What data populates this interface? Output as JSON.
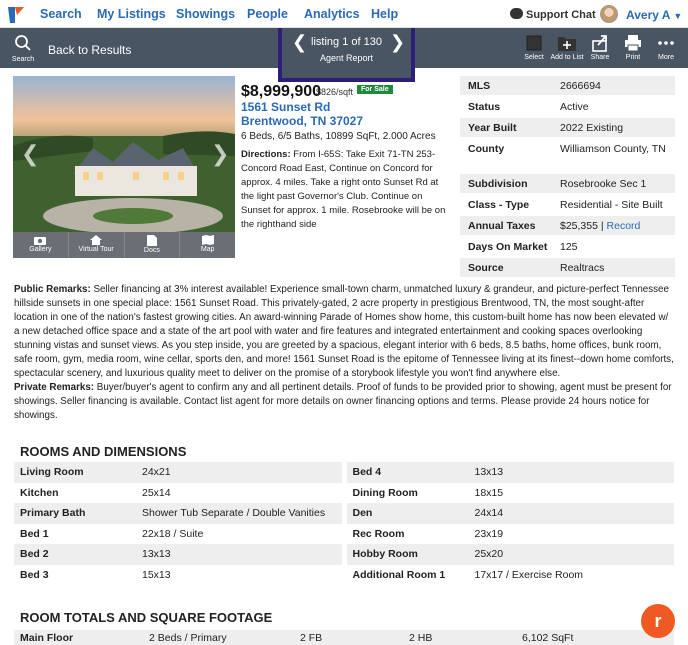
{
  "nav": {
    "links": [
      "Search",
      "My Listings",
      "Showings",
      "People",
      "Analytics",
      "Help"
    ],
    "support": "Support Chat",
    "user": "Avery A"
  },
  "toolbar": {
    "search_label": "Search",
    "back_label": "Back to Results",
    "listing_count": "listing 1 of 130",
    "report": "Agent Report",
    "actions": [
      "Select",
      "Add to List",
      "Share",
      "Print",
      "More"
    ]
  },
  "photo_tabs": [
    "Gallery",
    "Virtual Tour",
    "Docs",
    "Map"
  ],
  "listing": {
    "price": "$8,999,900",
    "price_sqft": "$826/sqft",
    "status_badge": "For Sale",
    "street": "1561 Sunset Rd",
    "city": "Brentwood, TN 37027",
    "summary": "6 Beds, 6/5 Baths, 10899 SqFt, 2.000 Acres",
    "directions_label": "Directions:",
    "directions": "From I-65S: Take Exit 71-TN 253-Concord Road East, Continue on Concord for approx. 4 miles. Take a right onto Sunset Rd at the light past Governor's Club. Continue on Sunset for approx. 1 mile. Rosebrooke will be on the righthand side"
  },
  "info": [
    {
      "k": "MLS",
      "v": "2666694"
    },
    {
      "k": "Status",
      "v": "Active"
    },
    {
      "k": "Year Built",
      "v": "2022 Existing"
    },
    {
      "k": "County",
      "v": "Williamson County, TN"
    },
    {
      "k": "Subdivision",
      "v": "Rosebrooke Sec 1"
    },
    {
      "k": "Class - Type",
      "v": "Residential - Site Built"
    },
    {
      "k": "Annual Taxes",
      "v": "$25,355",
      "link": "Record"
    },
    {
      "k": "Days On Market",
      "v": "125"
    },
    {
      "k": "Source",
      "v": "Realtracs"
    }
  ],
  "remarks": {
    "public_label": "Public Remarks:",
    "public": "Seller financing at 3% interest available! Experience small-town charm, unmatched luxury & grandeur, and picture-perfect Tennessee hillside sunsets in one special place: 1561 Sunset Road. This privately-gated, 2 acre property in prestigious Brentwood, TN, the most sought-after location in one of the nation's fastest growing cities. An award-winning Parade of Homes show home, this custom-built home has now been elevated w/ a new detached office space and a state of the art pool with water and fire features and integrated entertainment and cooking spaces overlooking stunning vistas and sunset views. As you step inside, you are greeted by a spacious, elegant interior with 6 beds, 8.5 baths, home offices, bunk room, safe room, gym, media room, wine cellar, sports den, and more! 1561 Sunset Road is the epitome of Tennessee living at its finest--down home comforts, spectacular scenery, and luxurious quality meet to deliver on the promise of a storybook lifestyle you won't find anywhere else.",
    "private_label": "Private Remarks:",
    "private": "Buyer/buyer's agent to confirm any and all pertinent details. Proof of funds to be provided prior to showing, agent must be present for showings. Seller financing is available. Contact list agent for more details on owner financing options and terms. Please provide 24 hours notice for showings."
  },
  "rooms_title": "ROOMS AND DIMENSIONS",
  "rooms": [
    [
      {
        "k": "Living Room",
        "v": "24x21"
      },
      {
        "k": "Bed 4",
        "v": "13x13"
      }
    ],
    [
      {
        "k": "Kitchen",
        "v": "25x14"
      },
      {
        "k": "Dining Room",
        "v": "18x15"
      }
    ],
    [
      {
        "k": "Primary Bath",
        "v": "Shower Tub Separate / Double Vanities"
      },
      {
        "k": "Den",
        "v": "24x14"
      }
    ],
    [
      {
        "k": "Bed 1",
        "v": "22x18 / Suite"
      },
      {
        "k": "Rec Room",
        "v": "23x19"
      }
    ],
    [
      {
        "k": "Bed 2",
        "v": "13x13"
      },
      {
        "k": "Hobby Room",
        "v": "25x20"
      }
    ],
    [
      {
        "k": "Bed 3",
        "v": "15x13"
      },
      {
        "k": "Additional Room 1",
        "v": "17x17 / Exercise Room"
      }
    ]
  ],
  "totals_title": "ROOM TOTALS AND SQUARE FOOTAGE",
  "totals": {
    "label": "Main Floor",
    "beds": "2 Beds / Primary",
    "fb": "2 FB",
    "hb": "2 HB",
    "sqft": "6,102 SqFt"
  },
  "colors": {
    "accent": "#2a6ab7",
    "toolbar": "#4a5563",
    "highlight": "#2b1f7a",
    "brand": "#f05a22",
    "badge": "#1f8a3a"
  }
}
